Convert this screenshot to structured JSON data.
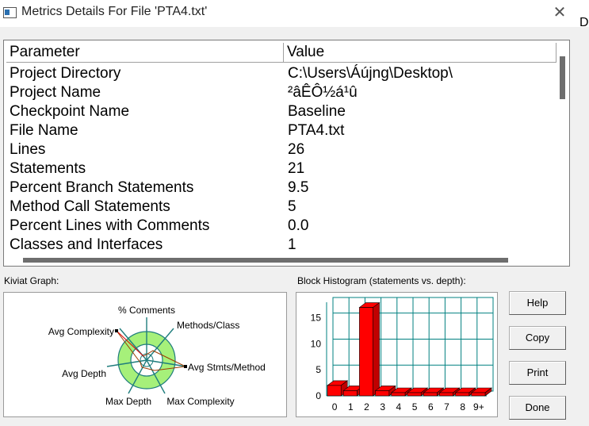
{
  "window": {
    "title": "Metrics Details For File 'PTA4.txt'",
    "close_glyph": "✕",
    "background_window_text": "De"
  },
  "table": {
    "headers": {
      "parameter": "Parameter",
      "value": "Value"
    },
    "rows": [
      {
        "parameter": "Project Directory",
        "value": "C:\\Users\\Áújng\\Desktop\\"
      },
      {
        "parameter": "Project Name",
        "value": "²âÊÔ½á¹û"
      },
      {
        "parameter": "Checkpoint Name",
        "value": "Baseline"
      },
      {
        "parameter": "File Name",
        "value": "PTA4.txt"
      },
      {
        "parameter": "Lines",
        "value": "26"
      },
      {
        "parameter": "Statements",
        "value": "21"
      },
      {
        "parameter": "Percent Branch Statements",
        "value": "9.5"
      },
      {
        "parameter": "Method Call Statements",
        "value": "5"
      },
      {
        "parameter": "Percent Lines with Comments",
        "value": "0.0"
      },
      {
        "parameter": "Classes and Interfaces",
        "value": "1"
      }
    ]
  },
  "kiviat": {
    "label": "Kiviat Graph:",
    "axes": [
      "% Comments",
      "Methods/Class",
      "Avg Stmts/Method",
      "Max Complexity",
      "Max Depth",
      "Avg Depth",
      "Avg Complexity"
    ]
  },
  "histogram": {
    "label": "Block Histogram (statements vs. depth):",
    "y_ticks": [
      "15",
      "10",
      "5",
      "0"
    ],
    "x_ticks": [
      "0",
      "1",
      "2",
      "3",
      "4",
      "5",
      "6",
      "7",
      "8",
      "9+"
    ],
    "values": [
      2,
      1,
      17,
      1,
      0,
      0,
      0,
      0,
      0,
      0
    ],
    "bar_color": "#ff0000",
    "grid_color": "#008080"
  },
  "buttons": {
    "help": "Help",
    "copy": "Copy",
    "print": "Print",
    "done": "Done"
  }
}
